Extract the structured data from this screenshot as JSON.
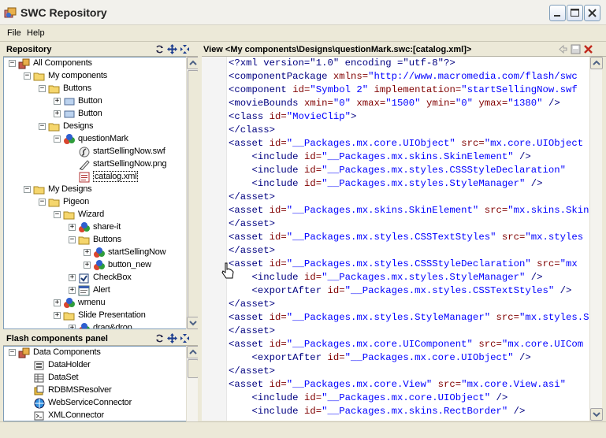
{
  "window": {
    "title": "SWC Repository"
  },
  "menu": {
    "file": "File",
    "help": "Help"
  },
  "repository": {
    "header": "Repository",
    "nodes": [
      {
        "label": "All Components",
        "depth": 0,
        "exp": "-",
        "icon": "components-icon"
      },
      {
        "label": "My components",
        "depth": 1,
        "exp": "-",
        "icon": "folder-open-icon"
      },
      {
        "label": "Buttons",
        "depth": 2,
        "exp": "-",
        "icon": "folder-open-icon"
      },
      {
        "label": "Button",
        "depth": 3,
        "exp": "+",
        "icon": "button-component-icon"
      },
      {
        "label": "Button",
        "depth": 3,
        "exp": "+",
        "icon": "button-component-icon"
      },
      {
        "label": "Designs",
        "depth": 2,
        "exp": "-",
        "icon": "folder-open-icon"
      },
      {
        "label": "questionMark",
        "depth": 3,
        "exp": "-",
        "icon": "swc-component-icon"
      },
      {
        "label": "startSellingNow.swf",
        "depth": 4,
        "exp": "",
        "icon": "swf-file-icon"
      },
      {
        "label": "startSellingNow.png",
        "depth": 4,
        "exp": "",
        "icon": "png-file-icon"
      },
      {
        "label": "catalog.xml",
        "depth": 4,
        "exp": "",
        "icon": "xml-file-icon",
        "selected": true
      },
      {
        "label": "My Designs",
        "depth": 1,
        "exp": "-",
        "icon": "folder-open-icon"
      },
      {
        "label": "Pigeon",
        "depth": 2,
        "exp": "-",
        "icon": "folder-open-icon"
      },
      {
        "label": "Wizard",
        "depth": 3,
        "exp": "-",
        "icon": "folder-open-icon"
      },
      {
        "label": "share-it",
        "depth": 4,
        "exp": "+",
        "icon": "swc-component-icon"
      },
      {
        "label": "Buttons",
        "depth": 4,
        "exp": "-",
        "icon": "folder-open-icon"
      },
      {
        "label": "startSellingNow",
        "depth": 5,
        "exp": "+",
        "icon": "swc-component-icon"
      },
      {
        "label": "button_new",
        "depth": 5,
        "exp": "+",
        "icon": "swc-component-icon"
      },
      {
        "label": "CheckBox",
        "depth": 4,
        "exp": "+",
        "icon": "checkbox-component-icon"
      },
      {
        "label": "Alert",
        "depth": 4,
        "exp": "+",
        "icon": "alert-component-icon"
      },
      {
        "label": "wmenu",
        "depth": 3,
        "exp": "+",
        "icon": "swc-component-icon"
      },
      {
        "label": "Slide Presentation",
        "depth": 3,
        "exp": "+",
        "icon": "folder-icon"
      },
      {
        "label": "drag&drop",
        "depth": 4,
        "exp": "+",
        "icon": "swc-component-icon"
      }
    ]
  },
  "flash_panel": {
    "header": "Flash components panel",
    "nodes": [
      {
        "label": "Data Components",
        "depth": 0,
        "exp": "-",
        "icon": "components-icon"
      },
      {
        "label": "DataHolder",
        "depth": 1,
        "exp": "",
        "icon": "data-holder-icon"
      },
      {
        "label": "DataSet",
        "depth": 1,
        "exp": "",
        "icon": "dataset-icon"
      },
      {
        "label": "RDBMSResolver",
        "depth": 1,
        "exp": "",
        "icon": "resolver-icon"
      },
      {
        "label": "WebServiceConnector",
        "depth": 1,
        "exp": "",
        "icon": "web-service-icon"
      },
      {
        "label": "XMLConnector",
        "depth": 1,
        "exp": "",
        "icon": "xml-connector-icon"
      }
    ]
  },
  "view": {
    "header": "View <My components\\Designs\\questionMark.swc:[catalog.xml]>",
    "lines": [
      [
        [
          "t",
          "<?xml version=\"1.0\" encoding =\"utf-8\"?>"
        ]
      ],
      [
        [
          "t",
          "<componentPackage "
        ],
        [
          "a",
          "xmlns="
        ],
        [
          "s",
          "\"http://www.macromedia.com/flash/swc"
        ]
      ],
      [
        [
          "t",
          "<component "
        ],
        [
          "a",
          "id="
        ],
        [
          "s",
          "\"Symbol 2\" "
        ],
        [
          "a",
          "implementation="
        ],
        [
          "s",
          "\"startSellingNow.swf"
        ]
      ],
      [
        [
          "t",
          "<movieBounds "
        ],
        [
          "a",
          "xmin="
        ],
        [
          "s",
          "\"0\" "
        ],
        [
          "a",
          "xmax="
        ],
        [
          "s",
          "\"1500\" "
        ],
        [
          "a",
          "ymin="
        ],
        [
          "s",
          "\"0\" "
        ],
        [
          "a",
          "ymax="
        ],
        [
          "s",
          "\"1380\" "
        ],
        [
          "t",
          "/>"
        ]
      ],
      [
        [
          "t",
          "<class "
        ],
        [
          "a",
          "id="
        ],
        [
          "s",
          "\"MovieClip\""
        ],
        [
          "t",
          ">"
        ]
      ],
      [
        [
          "t",
          "</class>"
        ]
      ],
      [
        [
          "t",
          "<asset "
        ],
        [
          "a",
          "id="
        ],
        [
          "s",
          "\"__Packages.mx.core.UIObject\" "
        ],
        [
          "a",
          "src="
        ],
        [
          "s",
          "\"mx.core.UIObject"
        ]
      ],
      [
        [
          "t",
          "    <include "
        ],
        [
          "a",
          "id="
        ],
        [
          "s",
          "\"__Packages.mx.skins.SkinElement\" "
        ],
        [
          "t",
          "/>"
        ]
      ],
      [
        [
          "t",
          "    <include "
        ],
        [
          "a",
          "id="
        ],
        [
          "s",
          "\"__Packages.mx.styles.CSSStyleDeclaration\""
        ]
      ],
      [
        [
          "t",
          "    <include "
        ],
        [
          "a",
          "id="
        ],
        [
          "s",
          "\"__Packages.mx.styles.StyleManager\" "
        ],
        [
          "t",
          "/>"
        ]
      ],
      [
        [
          "t",
          "</asset>"
        ]
      ],
      [
        [
          "t",
          "<asset "
        ],
        [
          "a",
          "id="
        ],
        [
          "s",
          "\"__Packages.mx.skins.SkinElement\" "
        ],
        [
          "a",
          "src="
        ],
        [
          "s",
          "\"mx.skins.Skin"
        ]
      ],
      [
        [
          "t",
          "</asset>"
        ]
      ],
      [
        [
          "t",
          "<asset "
        ],
        [
          "a",
          "id="
        ],
        [
          "s",
          "\"__Packages.mx.styles.CSSTextStyles\" "
        ],
        [
          "a",
          "src="
        ],
        [
          "s",
          "\"mx.styles"
        ]
      ],
      [
        [
          "t",
          "</asset>"
        ]
      ],
      [
        [
          "t",
          "<asset "
        ],
        [
          "a",
          "id="
        ],
        [
          "s",
          "\"__Packages.mx.styles.CSSStyleDeclaration\" "
        ],
        [
          "a",
          "src="
        ],
        [
          "s",
          "\"mx"
        ]
      ],
      [
        [
          "t",
          "    <include "
        ],
        [
          "a",
          "id="
        ],
        [
          "s",
          "\"__Packages.mx.styles.StyleManager\" "
        ],
        [
          "t",
          "/>"
        ]
      ],
      [
        [
          "t",
          "    <exportAfter "
        ],
        [
          "a",
          "id="
        ],
        [
          "s",
          "\"__Packages.mx.styles.CSSTextStyles\" "
        ],
        [
          "t",
          "/>"
        ]
      ],
      [
        [
          "t",
          "</asset>"
        ]
      ],
      [
        [
          "t",
          "<asset "
        ],
        [
          "a",
          "id="
        ],
        [
          "s",
          "\"__Packages.mx.styles.StyleManager\" "
        ],
        [
          "a",
          "src="
        ],
        [
          "s",
          "\"mx.styles.S"
        ]
      ],
      [
        [
          "t",
          "</asset>"
        ]
      ],
      [
        [
          "t",
          "<asset "
        ],
        [
          "a",
          "id="
        ],
        [
          "s",
          "\"__Packages.mx.core.UIComponent\" "
        ],
        [
          "a",
          "src="
        ],
        [
          "s",
          "\"mx.core.UICom"
        ]
      ],
      [
        [
          "t",
          "    <exportAfter "
        ],
        [
          "a",
          "id="
        ],
        [
          "s",
          "\"__Packages.mx.core.UIObject\" "
        ],
        [
          "t",
          "/>"
        ]
      ],
      [
        [
          "t",
          "</asset>"
        ]
      ],
      [
        [
          "t",
          "<asset "
        ],
        [
          "a",
          "id="
        ],
        [
          "s",
          "\"__Packages.mx.core.View\" "
        ],
        [
          "a",
          "src="
        ],
        [
          "s",
          "\"mx.core.View.asi\""
        ]
      ],
      [
        [
          "t",
          "    <include "
        ],
        [
          "a",
          "id="
        ],
        [
          "s",
          "\"__Packages.mx.core.UIObject\" "
        ],
        [
          "t",
          "/>"
        ]
      ],
      [
        [
          "t",
          "    <include "
        ],
        [
          "a",
          "id="
        ],
        [
          "s",
          "\"__Packages.mx.skins.RectBorder\" "
        ],
        [
          "t",
          "/>"
        ]
      ]
    ]
  },
  "colors": {
    "tag": "#000080",
    "attr": "#800000",
    "string": "#0000ff",
    "chrome": "#ECE9D8"
  }
}
